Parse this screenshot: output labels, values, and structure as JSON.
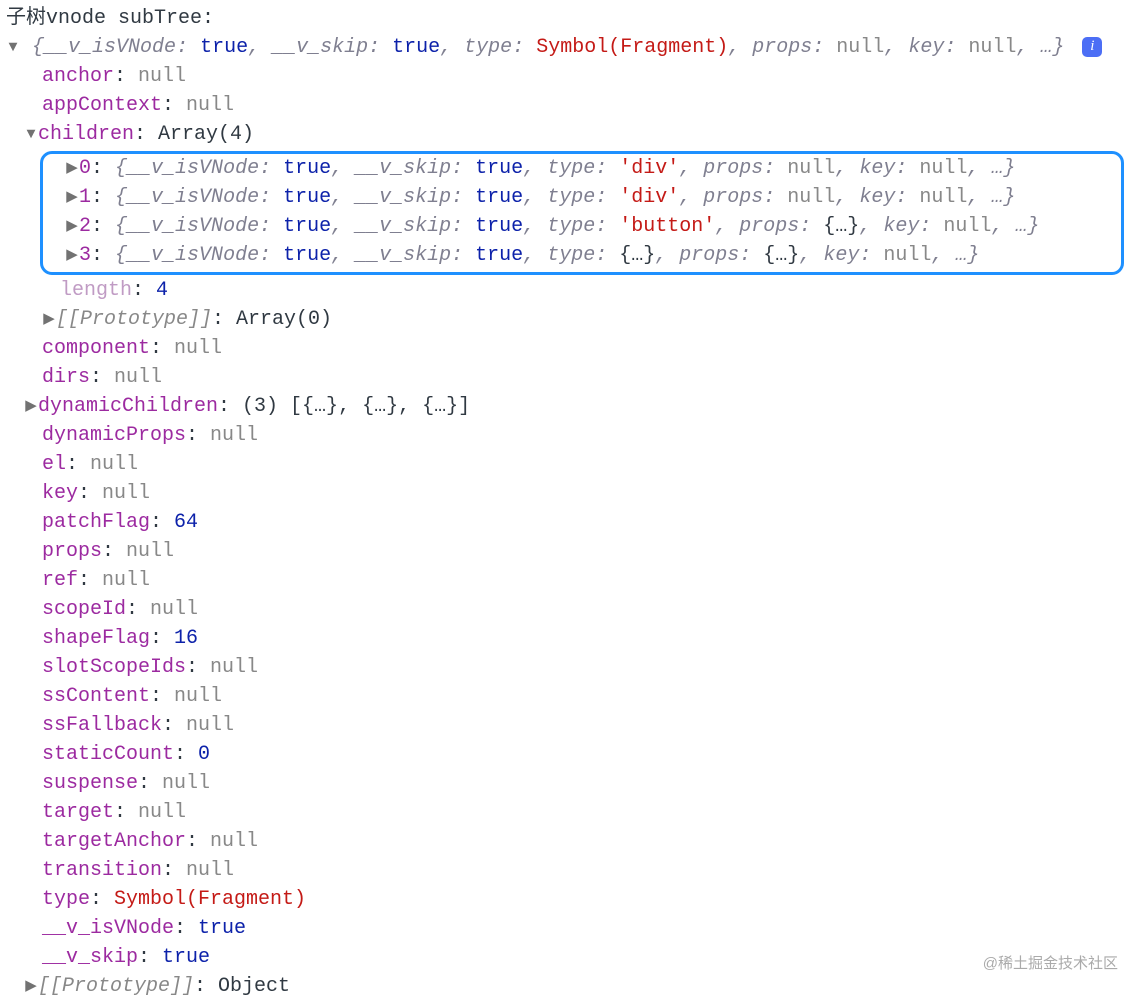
{
  "title": "子树vnode subTree:",
  "summary": {
    "k1": "__v_isVNode",
    "v1": "true",
    "k2": "__v_skip",
    "v2": "true",
    "k3": "type",
    "v3": "Symbol(Fragment)",
    "k4": "props",
    "v4": "null",
    "k5": "key",
    "v5": "null",
    "tail": ", …}"
  },
  "anchor": {
    "k": "anchor",
    "v": "null"
  },
  "appContext": {
    "k": "appContext",
    "v": "null"
  },
  "children": {
    "k": "children",
    "v": "Array(4)"
  },
  "childRows": [
    {
      "idx": "0",
      "k1": "__v_isVNode",
      "v1": "true",
      "k2": "__v_skip",
      "v2": "true",
      "k3": "type",
      "v3": "'div'",
      "k4": "props",
      "v4": "null",
      "k5": "key",
      "v5": "null",
      "tail": ", …}"
    },
    {
      "idx": "1",
      "k1": "__v_isVNode",
      "v1": "true",
      "k2": "__v_skip",
      "v2": "true",
      "k3": "type",
      "v3": "'div'",
      "k4": "props",
      "v4": "null",
      "k5": "key",
      "v5": "null",
      "tail": ", …}"
    },
    {
      "idx": "2",
      "k1": "__v_isVNode",
      "v1": "true",
      "k2": "__v_skip",
      "v2": "true",
      "k3": "type",
      "v3": "'button'",
      "k4": "props",
      "v4": "{…}",
      "k5": "key",
      "v5": "null",
      "tail": ", …}"
    },
    {
      "idx": "3",
      "k1": "__v_isVNode",
      "v1": "true",
      "k2": "__v_skip",
      "v2": "true",
      "k3": "type",
      "v3": "{…}",
      "k4": "props",
      "v4": "{…}",
      "k5": "key",
      "v5": "null",
      "tail": ", …}"
    }
  ],
  "length": {
    "k": "length",
    "v": "4"
  },
  "proto1": {
    "k": "[[Prototype]]",
    "v": "Array(0)"
  },
  "component": {
    "k": "component",
    "v": "null"
  },
  "dirs": {
    "k": "dirs",
    "v": "null"
  },
  "dynamicChildren": {
    "k": "dynamicChildren",
    "v": "(3) [{…}, {…}, {…}]"
  },
  "dynamicProps": {
    "k": "dynamicProps",
    "v": "null"
  },
  "el": {
    "k": "el",
    "v": "null"
  },
  "keyProp": {
    "k": "key",
    "v": "null"
  },
  "patchFlag": {
    "k": "patchFlag",
    "v": "64"
  },
  "props": {
    "k": "props",
    "v": "null"
  },
  "ref": {
    "k": "ref",
    "v": "null"
  },
  "scopeId": {
    "k": "scopeId",
    "v": "null"
  },
  "shapeFlag": {
    "k": "shapeFlag",
    "v": "16"
  },
  "slotScopeIds": {
    "k": "slotScopeIds",
    "v": "null"
  },
  "ssContent": {
    "k": "ssContent",
    "v": "null"
  },
  "ssFallback": {
    "k": "ssFallback",
    "v": "null"
  },
  "staticCount": {
    "k": "staticCount",
    "v": "0"
  },
  "suspense": {
    "k": "suspense",
    "v": "null"
  },
  "target": {
    "k": "target",
    "v": "null"
  },
  "targetAnchor": {
    "k": "targetAnchor",
    "v": "null"
  },
  "transition": {
    "k": "transition",
    "v": "null"
  },
  "typeProp": {
    "k": "type",
    "v": "Symbol(Fragment)"
  },
  "vIsVNode": {
    "k": "__v_isVNode",
    "v": "true"
  },
  "vSkip": {
    "k": "__v_skip",
    "v": "true"
  },
  "proto2": {
    "k": "[[Prototype]]",
    "v": "Object"
  },
  "watermark": "@稀土掘金技术社区"
}
